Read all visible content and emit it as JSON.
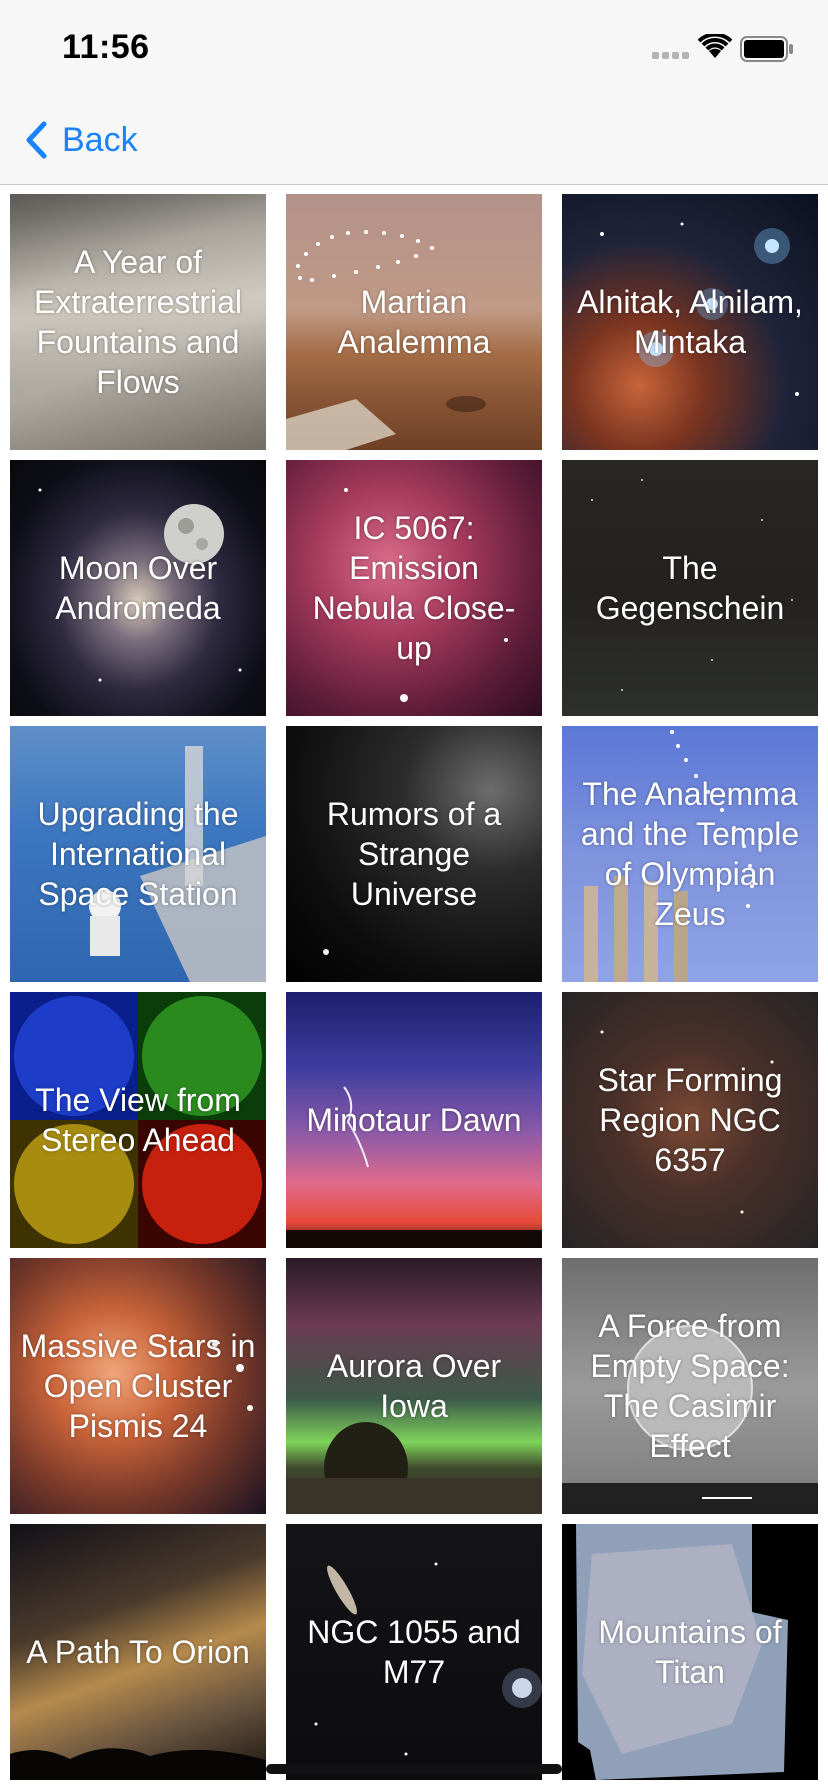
{
  "status": {
    "time": "11:56"
  },
  "nav": {
    "back_label": "Back"
  },
  "tiles": [
    {
      "title": "A Year of Extraterrestrial Fountains and Flows"
    },
    {
      "title": "Martian Analemma"
    },
    {
      "title": "Alnitak, Alnilam, Mintaka"
    },
    {
      "title": "Moon Over Andromeda"
    },
    {
      "title": "IC 5067: Emission Nebula Close-up"
    },
    {
      "title": "The Gegenschein"
    },
    {
      "title": "Upgrading the International Space Station"
    },
    {
      "title": "Rumors of a Strange Universe"
    },
    {
      "title": "The Analemma and the Temple of Olympian Zeus"
    },
    {
      "title": "The View from Stereo Ahead"
    },
    {
      "title": "Minotaur Dawn"
    },
    {
      "title": "Star Forming Region NGC 6357"
    },
    {
      "title": "Massive Stars in Open Cluster Pismis 24"
    },
    {
      "title": "Aurora Over Iowa"
    },
    {
      "title": "A Force from Empty Space: The Casimir Effect"
    },
    {
      "title": "A Path To Orion"
    },
    {
      "title": "NGC 1055 and M77"
    },
    {
      "title": "Mountains of Titan"
    }
  ],
  "colors": {
    "accent": "#1a82fb",
    "bar_background": "#f7f7f7"
  }
}
